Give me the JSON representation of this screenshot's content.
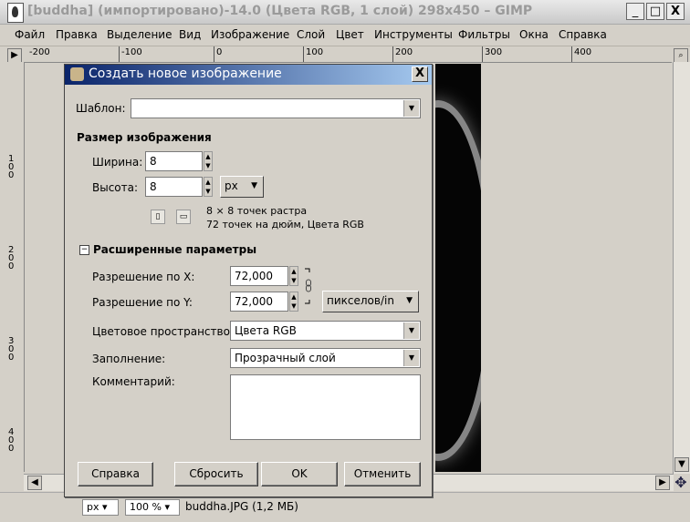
{
  "window": {
    "title": "[buddha] (импортировано)-14.0 (Цвета RGB, 1 слой) 298x450 – GIMP",
    "controls": [
      "_",
      "□",
      "X"
    ]
  },
  "menu": [
    "Файл",
    "Правка",
    "Выделение",
    "Вид",
    "Изображение",
    "Слой",
    "Цвет",
    "Инструменты",
    "Фильтры",
    "Окна",
    "Справка"
  ],
  "ruler_top": [
    "-200",
    "-100",
    "0",
    "100",
    "200",
    "300",
    "400"
  ],
  "ruler_left": [
    "1\n0\n0",
    "2\n0\n0",
    "3\n0\n0",
    "4\n0\n0"
  ],
  "status": {
    "unit": "px",
    "zoom": "100 %",
    "file": "buddha.JPG (1,2 МБ)"
  },
  "dialog": {
    "title": "Создать новое изображение",
    "close": "X",
    "template_label": "Шаблон:",
    "template_value": "",
    "size_heading": "Размер изображения",
    "width_label": "Ширина:",
    "width_value": "8",
    "height_label": "Высота:",
    "height_value": "8",
    "size_unit": "px",
    "size_info_1": "8 × 8 точек растра",
    "size_info_2": "72 точек на дюйм, Цвета RGB",
    "advanced_heading": "Расширенные параметры",
    "advanced_toggle": "−",
    "xres_label": "Разрешение по X:",
    "xres_value": "72,000",
    "yres_label": "Разрешение по Y:",
    "yres_value": "72,000",
    "res_unit": "пикселов/in",
    "colorspace_label": "Цветовое пространство:",
    "colorspace_value": "Цвета RGB",
    "fill_label": "Заполнение:",
    "fill_value": "Прозрачный слой",
    "comment_label": "Комментарий:",
    "comment_value": "",
    "buttons": {
      "help": "Справка",
      "reset": "Сбросить",
      "ok": "OK",
      "cancel": "Отменить"
    }
  }
}
